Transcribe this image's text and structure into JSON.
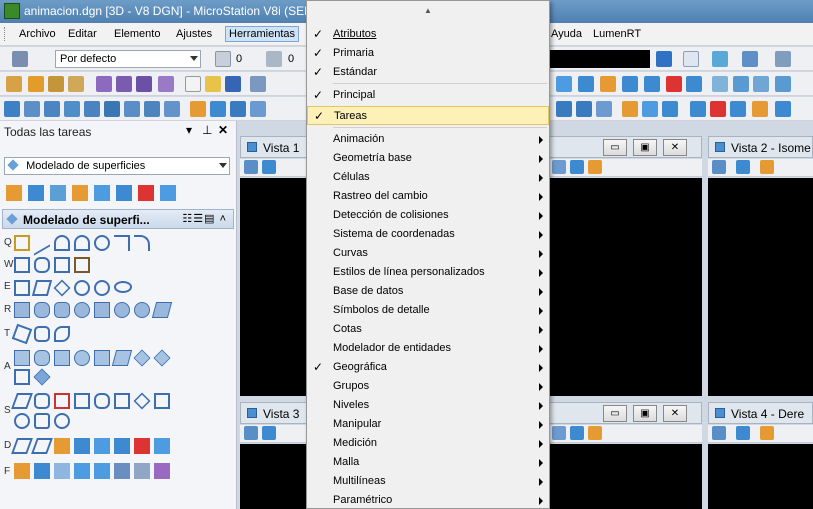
{
  "window": {
    "title": "animacion.dgn [3D - V8 DGN] - MicroStation V8i (SEL",
    "app_icon": "microstation-icon"
  },
  "menubar": {
    "items": [
      {
        "label": "Archivo"
      },
      {
        "label": "Editar"
      },
      {
        "label": "Elemento"
      },
      {
        "label": "Ajustes"
      },
      {
        "label": "Herramientas"
      },
      {
        "label": "Ayuda"
      },
      {
        "label": "LumenRT"
      }
    ]
  },
  "toolbar1": {
    "level_combo": "Por defecto",
    "color_value": "0",
    "weight_value": "0"
  },
  "task_panel": {
    "title": "Todas las tareas",
    "controls": [
      "▾",
      "⊥",
      "✕"
    ],
    "combo_value": "Modelado de superficies",
    "header_title": "Modelado de superfi...",
    "header_controls": "☷☰▤ ˄",
    "rows": [
      {
        "key": "Q",
        "count": 8
      },
      {
        "key": "W",
        "count": 5
      },
      {
        "key": "E",
        "count": 6
      },
      {
        "key": "R",
        "count": 8
      },
      {
        "key": "T",
        "count": 3
      },
      {
        "key": "A",
        "count": 9
      },
      {
        "key": "S",
        "count": 9
      },
      {
        "key": "D",
        "count": 8
      },
      {
        "key": "F",
        "count": 8
      }
    ]
  },
  "views": [
    {
      "title": "Vista 1",
      "has_buttons": true
    },
    {
      "title": "Vista 2 - Isome",
      "has_buttons": false
    },
    {
      "title": "Vista 3",
      "has_buttons": true
    },
    {
      "title": "Vista 4 - Dere",
      "has_buttons": false
    }
  ],
  "view_buttons": {
    "minimize": "▭",
    "restore": "▣",
    "close": "✕"
  },
  "context_menu": {
    "scroll_indicator": "▲",
    "checked_items": [
      {
        "label": "Atributos",
        "underline": "A",
        "checked": true
      },
      {
        "label": "Primaria",
        "checked": true
      },
      {
        "label": "Estándar",
        "checked": true
      },
      {
        "label": "Principal",
        "checked": true
      },
      {
        "label": "Tareas",
        "checked": true,
        "highlighted": true
      }
    ],
    "submenu_items": [
      {
        "label": "Animación",
        "checked": false
      },
      {
        "label": "Geometría base",
        "checked": false
      },
      {
        "label": "Células",
        "checked": false
      },
      {
        "label": "Rastreo del cambio",
        "checked": false
      },
      {
        "label": "Detección de colisiones",
        "checked": false
      },
      {
        "label": "Sistema de coordenadas",
        "checked": false
      },
      {
        "label": "Curvas",
        "checked": false
      },
      {
        "label": "Estilos de línea personalizados",
        "checked": false
      },
      {
        "label": "Base de datos",
        "checked": false
      },
      {
        "label": "Símbolos de detalle",
        "checked": false
      },
      {
        "label": "Cotas",
        "checked": false
      },
      {
        "label": "Modelador de entidades",
        "checked": false
      },
      {
        "label": "Geográfica",
        "checked": true
      },
      {
        "label": "Grupos",
        "checked": false
      },
      {
        "label": "Niveles",
        "checked": false
      },
      {
        "label": "Manipular",
        "checked": false
      },
      {
        "label": "Medición",
        "checked": false
      },
      {
        "label": "Malla",
        "checked": false
      },
      {
        "label": "Multilíneas",
        "checked": false
      },
      {
        "label": "Paramétrico",
        "checked": false
      }
    ],
    "check_glyph": "✓"
  },
  "colors": {
    "title_bar": "#4f80b0",
    "menu_highlight": "#fdf1b8",
    "view_background": "#000000",
    "accent": "#4a90d0"
  }
}
